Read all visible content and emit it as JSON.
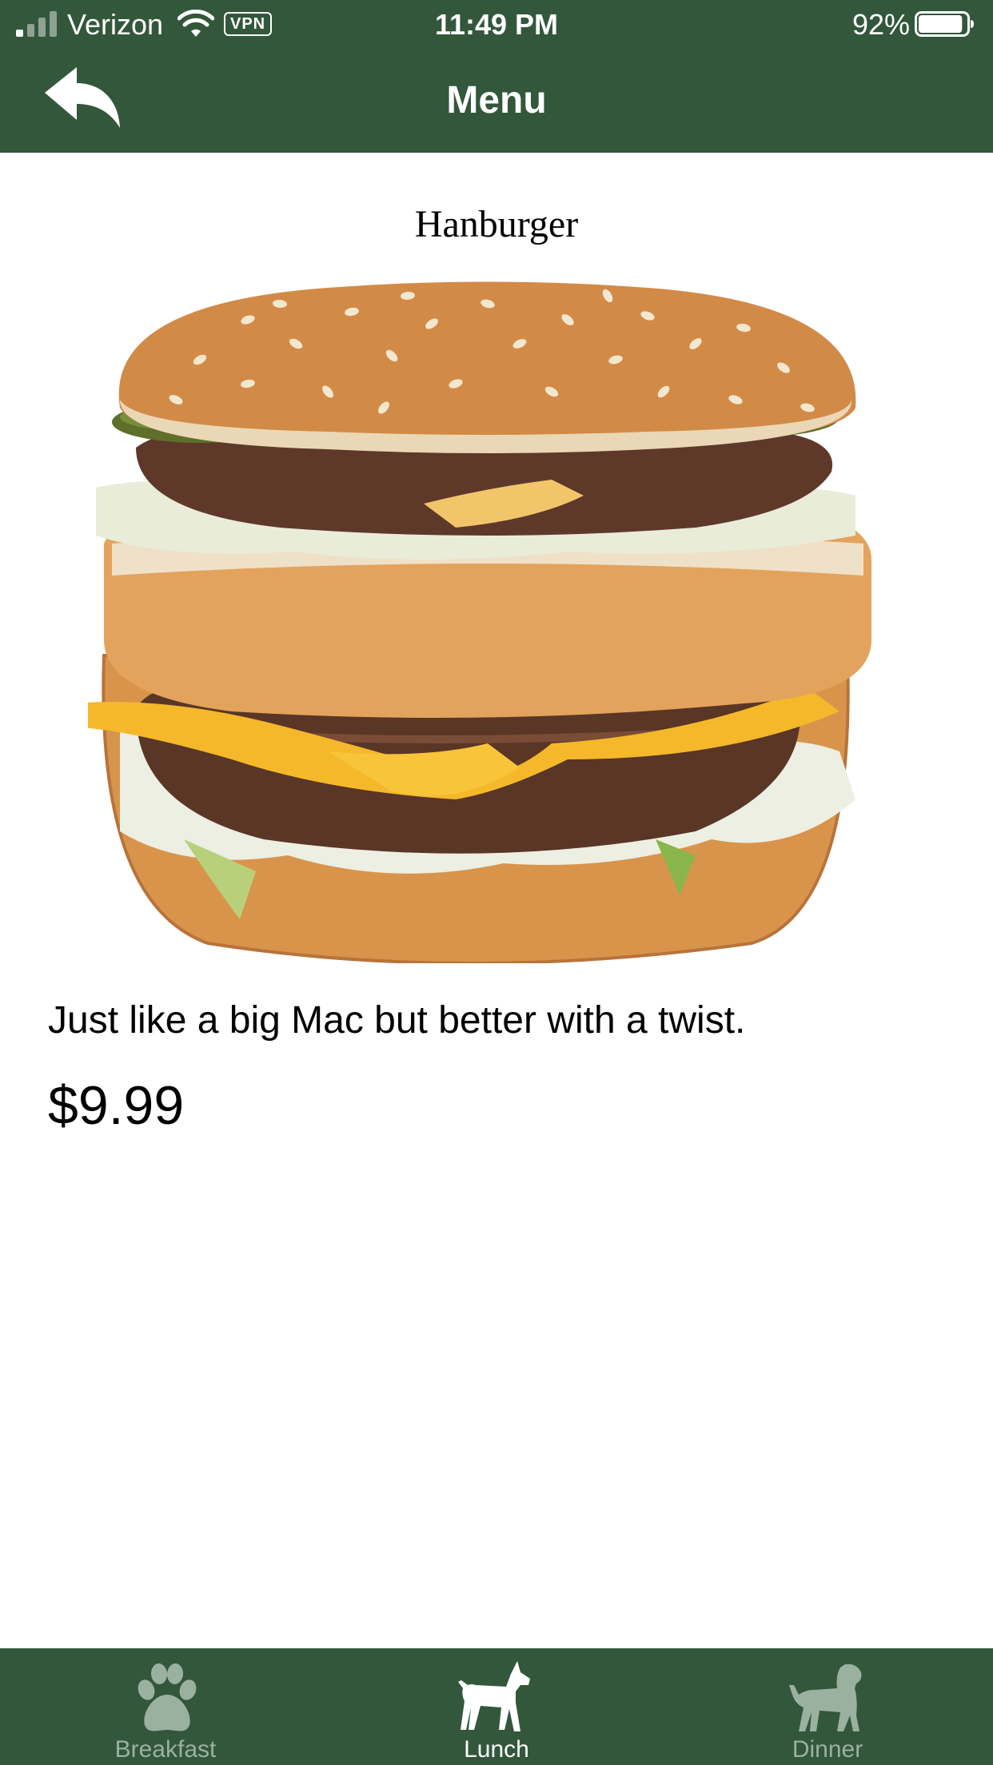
{
  "status_bar": {
    "carrier": "Verizon",
    "vpn_badge": "VPN",
    "time": "11:49 PM",
    "battery_percent": "92%",
    "battery_level": 0.92,
    "signal_bars_on": 1,
    "signal_bars_total": 4
  },
  "nav": {
    "title": "Menu",
    "back_icon": "back-reply-arrow-icon"
  },
  "item": {
    "name": "Hanburger",
    "description": "Just like a big Mac but better with a twist.",
    "price": "$9.99",
    "image_icon": "double-cheeseburger-photo"
  },
  "tabs": [
    {
      "label": "Breakfast",
      "icon": "paw-print-icon",
      "active": false
    },
    {
      "label": "Lunch",
      "icon": "dog-icon",
      "active": true
    },
    {
      "label": "Dinner",
      "icon": "monkey-icon",
      "active": false
    }
  ],
  "colors": {
    "header_green": "#33573b",
    "tab_inactive": "#9bb1a0",
    "tab_active": "#ffffff"
  }
}
